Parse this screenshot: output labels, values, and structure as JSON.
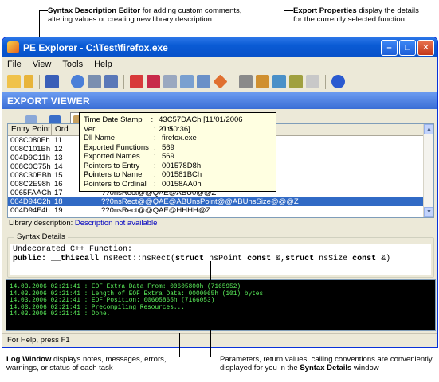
{
  "callouts": {
    "syntax_editor": {
      "title": "Syntax Description Editor",
      "text1": " for adding custom comments,",
      "text2": "altering values or creating new library description"
    },
    "export_props": {
      "title": "Export Properties",
      "text1": " display the details",
      "text2": "for the currently selected function"
    },
    "log_window": {
      "title": "Log Window",
      "text1": " displays notes, messages, errors,",
      "text2": "warnings, or status of each task"
    },
    "syntax_details": {
      "text1": "Parameters, return values, calling conventions are conveniently",
      "text2_pre": "displayed for you in the ",
      "title": "Syntax Details",
      "text2_post": " window"
    }
  },
  "window": {
    "title": "PE Explorer - C:\\Test\\firefox.exe"
  },
  "menu": {
    "file": "File",
    "view": "View",
    "tools": "Tools",
    "help": "Help"
  },
  "section_title": "EXPORT VIEWER",
  "grid": {
    "headers": [
      "Entry Point",
      "Ord"
    ],
    "rows": [
      {
        "entry": "008C080Fh",
        "ord": "11",
        "name": ""
      },
      {
        "entry": "008C101Bh",
        "ord": "12",
        "name": ""
      },
      {
        "entry": "004D9C11h",
        "ord": "13",
        "name": ""
      },
      {
        "entry": "008C0C75h",
        "ord": "14",
        "name": ""
      },
      {
        "entry": "008C30EBh",
        "ord": "15",
        "name": ""
      },
      {
        "entry": "008C2E98h",
        "ord": "16",
        "name": ""
      },
      {
        "entry": "0065FAACh",
        "ord": "17",
        "name": "??0nsRect@@QAE@ABU0@@Z"
      },
      {
        "entry": "004D94C2h",
        "ord": "18",
        "name": "??0nsRect@@QAE@ABUnsPoint@@ABUnsSize@@@Z"
      },
      {
        "entry": "004D94F4h",
        "ord": "19",
        "name": "??0nsRect@@QAE@HHHH@Z"
      }
    ]
  },
  "tooltip": [
    {
      "k": "Time Date Stamp",
      "v": "43C57DACh [11/01/2006  21:50:36]"
    },
    {
      "k": "Ver",
      "v": "0.0"
    },
    {
      "k": "Dll Name",
      "v": "firefox.exe"
    },
    {
      "k": "Exported Functions",
      "v": "569"
    },
    {
      "k": "Exported Names",
      "v": "569"
    },
    {
      "k": "Pointers to Entry Point",
      "v": "001578D8h"
    },
    {
      "k": "Pointers to Name",
      "v": "001581BCh"
    },
    {
      "k": "Pointers to Ordinal",
      "v": "00158AA0h"
    }
  ],
  "library": {
    "label": "Library description:",
    "value": "Description not available"
  },
  "syntax": {
    "legend": "Syntax Details",
    "line1": "Undecorated C++ Function:",
    "public": "public:",
    "thiscall": " __thiscall",
    "sig1": " nsRect::nsRect(",
    "struct1": "struct",
    "sig2": " nsPoint ",
    "const1": "const",
    "sig3": " &,",
    "struct2": "struct",
    "sig4": " nsSize ",
    "const2": "const",
    "sig5": " &)"
  },
  "log": [
    "14.03.2006 02:21:41 : EOF Extra Data From: 00605800h  (7165952)",
    "14.03.2006 02:21:41 : Length of EOF Extra Data: 0000065h  (101) bytes.",
    "14.03.2006 02:21:41 : EOF Position: 00605865h  (7166053)",
    "14.03.2006 02:21:41 : Precompiling Resources...",
    "14.03.2006 02:21:41 : Done."
  ],
  "status": "For Help, press F1"
}
